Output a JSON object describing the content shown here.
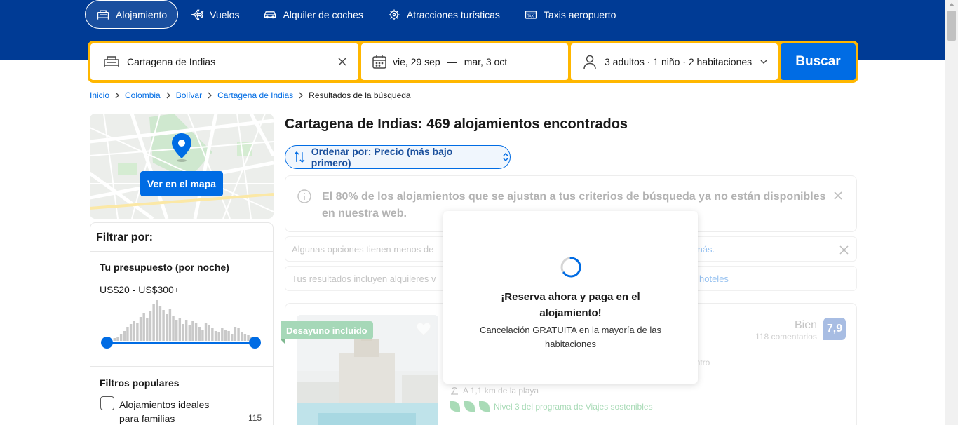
{
  "nav": {
    "items": [
      {
        "label": "Alojamiento",
        "icon": "bed-icon",
        "active": true
      },
      {
        "label": "Vuelos",
        "icon": "plane-icon"
      },
      {
        "label": "Alquiler de coches",
        "icon": "car-icon"
      },
      {
        "label": "Atracciones turísticas",
        "icon": "attractions-icon"
      },
      {
        "label": "Taxis aeropuerto",
        "icon": "taxi-icon"
      }
    ]
  },
  "search": {
    "destination": "Cartagena de Indias",
    "date_start": "vie, 29 sep",
    "date_sep": "—",
    "date_end": "mar, 3 oct",
    "guests": "3 adultos · 1 niño · 2 habitaciones",
    "button": "Buscar"
  },
  "breadcrumb": {
    "items": [
      "Inicio",
      "Colombia",
      "Bolívar",
      "Cartagena de Indias"
    ],
    "current": "Resultados de la búsqueda"
  },
  "map": {
    "button": "Ver en el mapa"
  },
  "filters": {
    "title": "Filtrar por:",
    "budget_title": "Tu presupuesto (por noche)",
    "budget_range": "US$20 - US$300+",
    "histogram": [
      4,
      6,
      10,
      14,
      20,
      24,
      28,
      26,
      34,
      40,
      32,
      42,
      52,
      58,
      50,
      44,
      38,
      46,
      36,
      30,
      32,
      24,
      30,
      22,
      28,
      26,
      20,
      16,
      26,
      22,
      18,
      14,
      12,
      18,
      16,
      14,
      10,
      20,
      18,
      12,
      10,
      8,
      6
    ],
    "popular_title": "Filtros populares",
    "popular": [
      {
        "label": "Alojamientos ideales para familias",
        "count": "115"
      }
    ]
  },
  "results": {
    "title": "Cartagena de Indias: 469 alojamientos encontrados",
    "sort": "Ordenar por: Precio (más bajo primero)",
    "banner1": "El 80% de los alojamientos que se ajustan a tus criterios de búsqueda ya no están disponibles en nuestra web.",
    "banner2_text": "Algunas opciones tienen menos de",
    "banner2_link": "más.",
    "banner3_text": "Tus resultados incluyen alquileres v",
    "banner3_link": "hoteles"
  },
  "property": {
    "badge": "Desayuno incluido",
    "rating_word": "Bien",
    "reviews": "118 comentarios",
    "score": "7,9",
    "centro": "entro",
    "beach": "A 1,1 km de la playa",
    "sustainable": "Nivel 3 del programa de Viajes sostenibles"
  },
  "modal": {
    "title": "¡Reserva ahora y paga en el alojamiento!",
    "subtitle": "Cancelación GRATUITA en la mayoría de las habitaciones"
  },
  "colors": {
    "header": "#003b95",
    "accent": "#006ce4",
    "searchbar_border": "#ffb700"
  }
}
